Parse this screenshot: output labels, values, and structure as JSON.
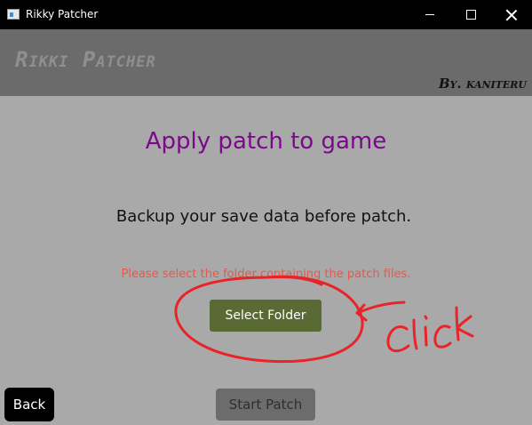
{
  "window": {
    "title": "Rikky Patcher",
    "controls": {
      "minimize": "minimize-icon",
      "maximize": "maximize-icon",
      "close": "close-icon"
    }
  },
  "header": {
    "app_title": "Rikki Patcher",
    "author": "By. kaniteru"
  },
  "main": {
    "heading": "Apply patch to game",
    "notice": "Backup your save data before patch.",
    "warning": "Please select the folder containing the patch files.",
    "select_folder_label": "Select Folder",
    "back_label": "Back",
    "start_patch_label": "Start Patch"
  },
  "annotation": {
    "text": "click",
    "color": "#e8242a"
  },
  "colors": {
    "header_bg": "#6b6b6b",
    "content_bg": "#a9a9a9",
    "heading": "#7b0a8a",
    "warning": "#e85848",
    "select_button": "#5a6a35"
  }
}
